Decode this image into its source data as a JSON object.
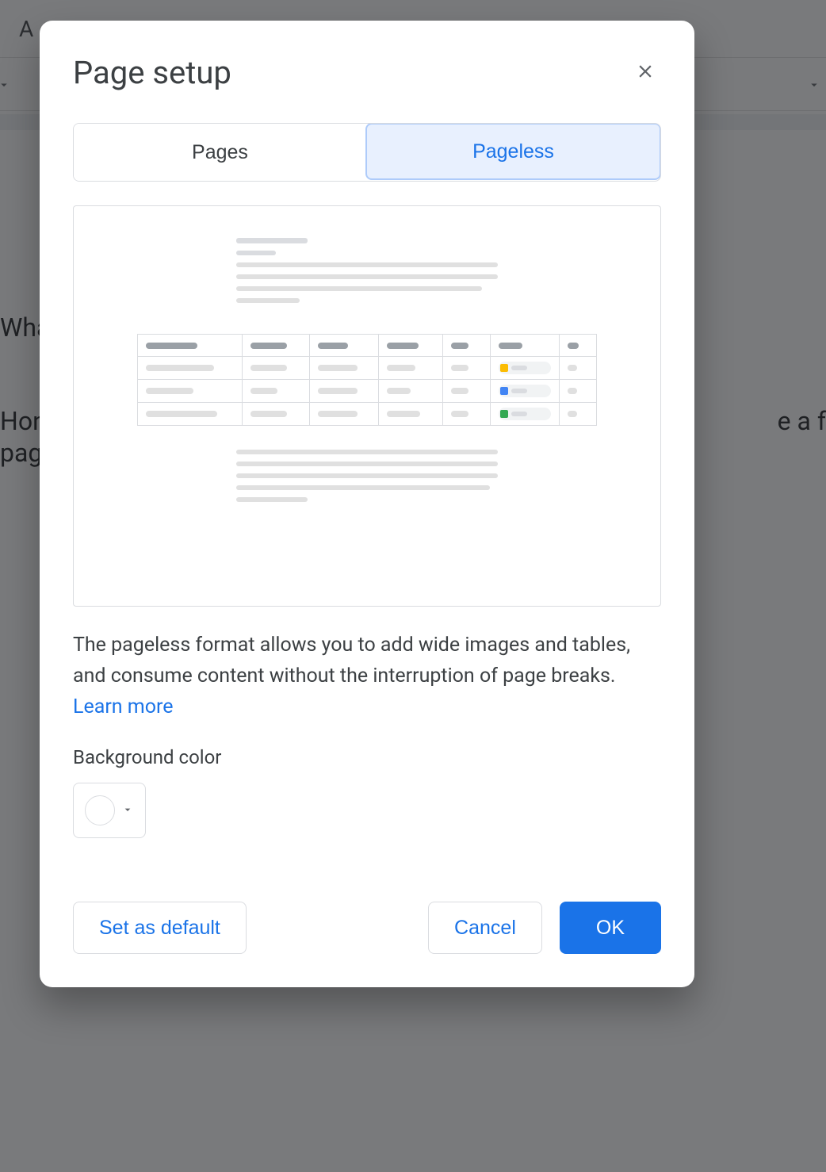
{
  "dialog": {
    "title": "Page setup",
    "tabs": {
      "pages": "Pages",
      "pageless": "Pageless"
    },
    "description_prefix": "The pageless format allows you to add wide images and tables, and consume content without the interruption of page breaks. ",
    "learn_more": "Learn more",
    "background_label": "Background color",
    "buttons": {
      "set_default": "Set as default",
      "cancel": "Cancel",
      "ok": "OK"
    }
  },
  "background": {
    "title_fragment": "A",
    "text1": "Wha",
    "text2": "Hon",
    "text3": "page",
    "text4": "e a f"
  }
}
